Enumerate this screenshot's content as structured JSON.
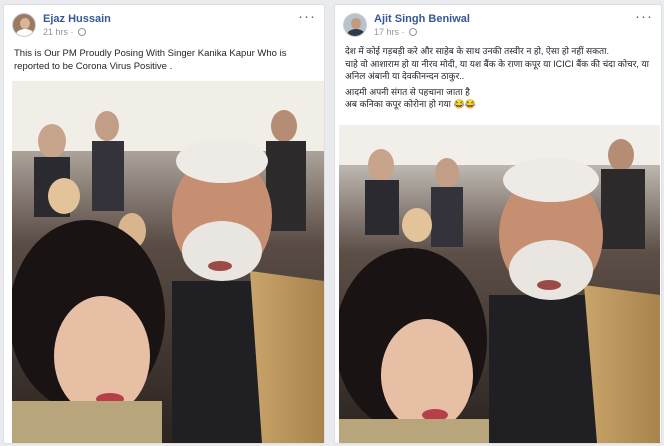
{
  "posts": [
    {
      "author": "Ejaz Hussain",
      "time": "21 hrs",
      "separator": "·",
      "more": "···",
      "text": [
        "This is Our PM Proudly Posing With Singer Kanika Kapur Who is reported to be Corona Virus Positive ."
      ],
      "photo_icon": "selfie-photo"
    },
    {
      "author": "Ajit Singh Beniwal",
      "time": "17 hrs",
      "separator": "·",
      "more": "···",
      "text": [
        "देश में कोई गड़बड़ी करे और साहेब के साथ उनकी तस्वीर न हो, ऐसा हो नहीं सकता.",
        "चाहे वो आशाराम हो या नीरव मोदी, या यश बैंक के राणा कपूर या ICICI बैंक की चंदा कोचर, या अनिल अंबानी या देवकीनन्दन ठाकुर..",
        "आदमी अपनी संगत से पहचाना जाता है",
        "अब कनिका कपूर कोरोना हो गया 😂😂"
      ],
      "photo_icon": "selfie-photo"
    }
  ],
  "colors": {
    "page_bg": "#e9ebee",
    "card_bg": "#ffffff",
    "author_link": "#365899",
    "meta_text": "#90949c",
    "body_text": "#1d2129"
  }
}
